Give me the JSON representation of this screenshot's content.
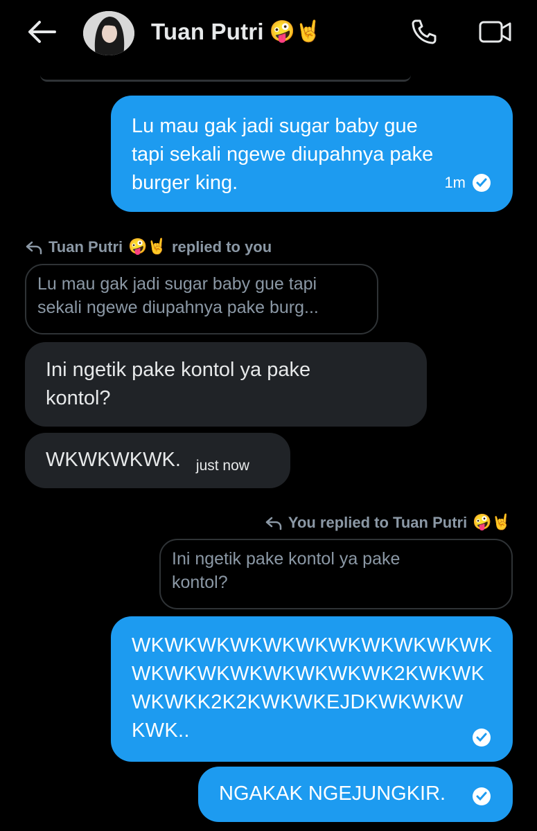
{
  "header": {
    "contact_name": "Tuan Putri",
    "contact_emojis": "🤪🤘"
  },
  "messages": [
    {
      "direction": "sent",
      "lines": [
        "Lu mau gak jadi sugar baby gue",
        "tapi sekali ngewe diupahnya pake",
        "burger king."
      ],
      "time": "1m"
    },
    {
      "direction": "received",
      "reply_label": "replied to you",
      "reply_author": "Tuan Putri",
      "reply_emojis": "🤪🤘",
      "quote_lines": [
        "Lu mau gak jadi sugar baby gue tapi",
        "sekali ngewe diupahnya pake burg..."
      ],
      "lines": [
        "Ini ngetik pake kontol ya pake",
        "kontol?"
      ]
    },
    {
      "direction": "received",
      "lines": [
        "WKWKWKWK."
      ],
      "time": "just now"
    },
    {
      "direction": "sent",
      "reply_label": "You replied to Tuan Putri",
      "reply_emojis": "🤪🤘",
      "quote_lines": [
        "Ini ngetik pake kontol ya pake",
        "kontol?"
      ],
      "lines": [
        "WKWKWKWKWKWKWKWKWKWKWK",
        "WKWKWKWKWKWKWKWK2KWKWK",
        "WKWKK2K2KWKWKEJDKWKWKW",
        "KWK.."
      ]
    },
    {
      "direction": "sent",
      "lines": [
        "NGAKAK NGEJUNGKIR."
      ]
    }
  ],
  "icons": {
    "back": "arrow-left-icon",
    "call": "phone-icon",
    "video": "video-camera-icon",
    "seen": "check-circle-icon",
    "reply": "reply-arrow-icon"
  },
  "colors": {
    "background": "#000000",
    "sent_bubble": "#1d9bf0",
    "received_bubble": "#202327",
    "muted_text": "#8b98a5"
  }
}
